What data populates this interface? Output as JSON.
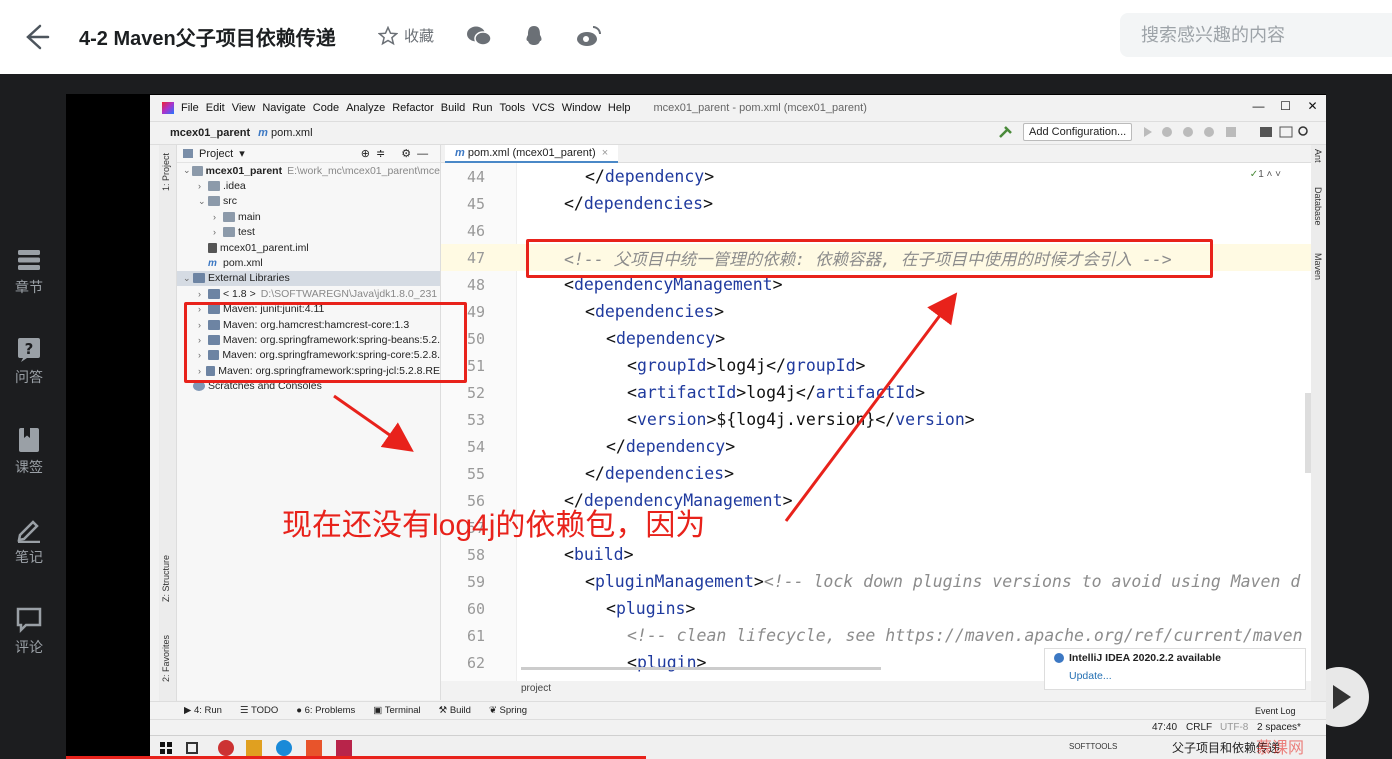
{
  "header": {
    "title": "4-2 Maven父子项目依赖传递",
    "favorite_label": "收藏",
    "search_placeholder": "搜索感兴趣的内容"
  },
  "sidebar": {
    "items": [
      {
        "label": "章节",
        "icon": "chapters-icon"
      },
      {
        "label": "问答",
        "icon": "question-icon"
      },
      {
        "label": "课签",
        "icon": "bookmark-icon"
      },
      {
        "label": "笔记",
        "icon": "pen-icon"
      },
      {
        "label": "评论",
        "icon": "comment-icon"
      }
    ]
  },
  "ide": {
    "menu": [
      "File",
      "Edit",
      "View",
      "Navigate",
      "Code",
      "Analyze",
      "Refactor",
      "Build",
      "Run",
      "Tools",
      "VCS",
      "Window",
      "Help"
    ],
    "window_title": "mcex01_parent - pom.xml (mcex01_parent)",
    "breadcrumb_project": "mcex01_parent",
    "breadcrumb_file": "pom.xml",
    "add_configuration": "Add Configuration...",
    "project_panel_title": "Project",
    "left_strip_project": "1: Project",
    "left_strip_structure": "Z: Structure",
    "left_strip_favorites": "2: Favorites",
    "right_strip": [
      "Ant",
      "Database",
      "Maven"
    ],
    "tree": [
      {
        "indent": 0,
        "arrow": "v",
        "icon": "folder",
        "label": "mcex01_parent",
        "extra": "E:\\work_mc\\mcex01_parent\\mce",
        "bold": true
      },
      {
        "indent": 1,
        "arrow": ">",
        "icon": "folder",
        "label": ".idea"
      },
      {
        "indent": 1,
        "arrow": "v",
        "icon": "folder",
        "label": "src"
      },
      {
        "indent": 2,
        "arrow": ">",
        "icon": "folder",
        "label": "main"
      },
      {
        "indent": 2,
        "arrow": ">",
        "icon": "folder",
        "label": "test"
      },
      {
        "indent": 1,
        "arrow": "",
        "icon": "iml",
        "label": "mcex01_parent.iml"
      },
      {
        "indent": 1,
        "arrow": "",
        "icon": "xml",
        "label": "pom.xml"
      },
      {
        "indent": 0,
        "arrow": "v",
        "icon": "lib",
        "label": "External Libraries",
        "highlight": true
      },
      {
        "indent": 1,
        "arrow": ">",
        "icon": "lib",
        "label": "< 1.8 >",
        "extra": "D:\\SOFTWAREGN\\Java\\jdk1.8.0_231"
      },
      {
        "indent": 1,
        "arrow": ">",
        "icon": "lib",
        "label": "Maven: junit:junit:4.11"
      },
      {
        "indent": 1,
        "arrow": ">",
        "icon": "lib",
        "label": "Maven: org.hamcrest:hamcrest-core:1.3"
      },
      {
        "indent": 1,
        "arrow": ">",
        "icon": "lib",
        "label": "Maven: org.springframework:spring-beans:5.2."
      },
      {
        "indent": 1,
        "arrow": ">",
        "icon": "lib",
        "label": "Maven: org.springframework:spring-core:5.2.8."
      },
      {
        "indent": 1,
        "arrow": ">",
        "icon": "lib",
        "label": "Maven: org.springframework:spring-jcl:5.2.8.RE"
      },
      {
        "indent": 0,
        "arrow": "",
        "icon": "scratch",
        "label": "Scratches and Consoles"
      }
    ],
    "editor_tab": "pom.xml (mcex01_parent)",
    "code": [
      {
        "ln": "44",
        "indent": 2,
        "parts": [
          [
            "br",
            "</"
          ],
          [
            "tag",
            "dependency"
          ],
          [
            "br",
            ">"
          ]
        ]
      },
      {
        "ln": "45",
        "indent": 1,
        "parts": [
          [
            "br",
            "</"
          ],
          [
            "tag",
            "dependencies"
          ],
          [
            "br",
            ">"
          ]
        ]
      },
      {
        "ln": "46",
        "indent": 0,
        "parts": []
      },
      {
        "ln": "47",
        "indent": 1,
        "parts": [
          [
            "cm",
            "<!-- 父项目中统一管理的依赖: 依赖容器, 在子项目中使用的时候才会引入 -->"
          ]
        ],
        "current": true
      },
      {
        "ln": "48",
        "indent": 1,
        "parts": [
          [
            "br",
            "<"
          ],
          [
            "tag",
            "dependencyManagement"
          ],
          [
            "br",
            ">"
          ]
        ]
      },
      {
        "ln": "49",
        "indent": 2,
        "parts": [
          [
            "br",
            "<"
          ],
          [
            "tag",
            "dependencies"
          ],
          [
            "br",
            ">"
          ]
        ]
      },
      {
        "ln": "50",
        "indent": 3,
        "parts": [
          [
            "br",
            "<"
          ],
          [
            "tag",
            "dependency"
          ],
          [
            "br",
            ">"
          ]
        ]
      },
      {
        "ln": "51",
        "indent": 4,
        "parts": [
          [
            "br",
            "<"
          ],
          [
            "tag",
            "groupId"
          ],
          [
            "br",
            ">"
          ],
          [
            "val",
            "log4j"
          ],
          [
            "br",
            "</"
          ],
          [
            "tag",
            "groupId"
          ],
          [
            "br",
            ">"
          ]
        ]
      },
      {
        "ln": "52",
        "indent": 4,
        "parts": [
          [
            "br",
            "<"
          ],
          [
            "tag",
            "artifactId"
          ],
          [
            "br",
            ">"
          ],
          [
            "val",
            "log4j"
          ],
          [
            "br",
            "</"
          ],
          [
            "tag",
            "artifactId"
          ],
          [
            "br",
            ">"
          ]
        ]
      },
      {
        "ln": "53",
        "indent": 4,
        "parts": [
          [
            "br",
            "<"
          ],
          [
            "tag",
            "version"
          ],
          [
            "br",
            ">"
          ],
          [
            "val",
            "${log4j.version}"
          ],
          [
            "br",
            "</"
          ],
          [
            "tag",
            "version"
          ],
          [
            "br",
            ">"
          ]
        ]
      },
      {
        "ln": "54",
        "indent": 3,
        "parts": [
          [
            "br",
            "</"
          ],
          [
            "tag",
            "dependency"
          ],
          [
            "br",
            ">"
          ]
        ]
      },
      {
        "ln": "55",
        "indent": 2,
        "parts": [
          [
            "br",
            "</"
          ],
          [
            "tag",
            "dependencies"
          ],
          [
            "br",
            ">"
          ]
        ]
      },
      {
        "ln": "56",
        "indent": 1,
        "parts": [
          [
            "br",
            "</"
          ],
          [
            "tag",
            "dependencyManagement"
          ],
          [
            "br",
            ">"
          ]
        ]
      },
      {
        "ln": "57",
        "indent": 0,
        "parts": []
      },
      {
        "ln": "58",
        "indent": 1,
        "parts": [
          [
            "br",
            "<"
          ],
          [
            "tag",
            "build"
          ],
          [
            "br",
            ">"
          ]
        ]
      },
      {
        "ln": "59",
        "indent": 2,
        "parts": [
          [
            "br",
            "<"
          ],
          [
            "tag",
            "pluginManagement"
          ],
          [
            "br",
            ">"
          ],
          [
            "cm",
            "<!-- lock down plugins versions to avoid using Maven d"
          ]
        ]
      },
      {
        "ln": "60",
        "indent": 3,
        "parts": [
          [
            "br",
            "<"
          ],
          [
            "tag",
            "plugins"
          ],
          [
            "br",
            ">"
          ]
        ]
      },
      {
        "ln": "61",
        "indent": 4,
        "parts": [
          [
            "cm",
            "<!-- clean lifecycle, see https://maven.apache.org/ref/current/maven"
          ]
        ]
      },
      {
        "ln": "62",
        "indent": 4,
        "parts": [
          [
            "br",
            "<"
          ],
          [
            "tag",
            "plugin"
          ],
          [
            "br",
            ">"
          ]
        ]
      }
    ],
    "editor_breadcrumb": "project",
    "inspection_count": "1",
    "notification_title": "IntelliJ IDEA 2020.2.2 available",
    "notification_link": "Update...",
    "bottom_tools": [
      "4: Run",
      "TODO",
      "6: Problems",
      "Terminal",
      "Build",
      "Spring"
    ],
    "event_log": "Event Log",
    "status": {
      "position": "47:40",
      "line_sep": "CRLF",
      "encoding": "UTF-8",
      "indent": "2 spaces*"
    },
    "taskbar_tray": "SOFTTOOLS",
    "taskbar_title": "父子项目和依赖传递"
  },
  "annotation": {
    "text": "现在还没有log4j的依赖包，因为",
    "color": "#e8221b"
  },
  "watermark": "慕课网"
}
